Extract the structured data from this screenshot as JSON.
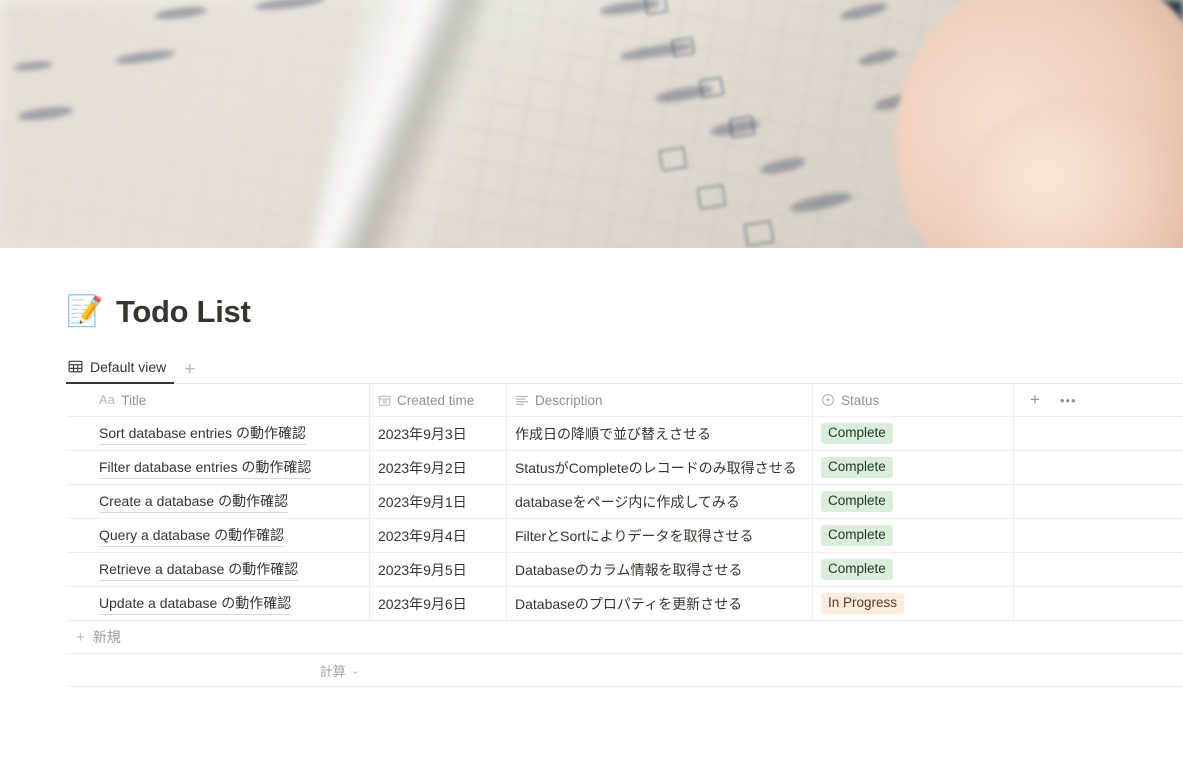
{
  "cover": {
    "alt": "blurred photo of a handwritten todo list on graph paper with a hand holding a pen"
  },
  "page": {
    "emoji": "📝",
    "title": "Todo List"
  },
  "view_tabs": {
    "tabs": [
      {
        "label": "Default view",
        "icon": "table-view-icon",
        "active": true
      }
    ],
    "add_label": "+"
  },
  "table": {
    "columns": [
      {
        "key": "title",
        "label": "Title",
        "icon": "title-text-icon"
      },
      {
        "key": "date",
        "label": "Created time",
        "icon": "calendar-icon"
      },
      {
        "key": "desc",
        "label": "Description",
        "icon": "text-lines-icon"
      },
      {
        "key": "status",
        "label": "Status",
        "icon": "select-circle-icon"
      }
    ],
    "header_actions": {
      "add": "+",
      "more": "•••"
    },
    "rows": [
      {
        "title": "Sort database entries の動作確認",
        "date": "2023年9月3日",
        "desc": "作成日の降順で並び替えさせる",
        "status": "Complete",
        "status_kind": "complete"
      },
      {
        "title": "Filter database entries の動作確認",
        "date": "2023年9月2日",
        "desc": "StatusがCompleteのレコードのみ取得させる",
        "status": "Complete",
        "status_kind": "complete"
      },
      {
        "title": "Create a database の動作確認",
        "date": "2023年9月1日",
        "desc": "databaseをページ内に作成してみる",
        "status": "Complete",
        "status_kind": "complete"
      },
      {
        "title": "Query a database の動作確認",
        "date": "2023年9月4日",
        "desc": "FilterとSortによりデータを取得させる",
        "status": "Complete",
        "status_kind": "complete"
      },
      {
        "title": "Retrieve a database の動作確認",
        "date": "2023年9月5日",
        "desc": "Databaseのカラム情報を取得させる",
        "status": "Complete",
        "status_kind": "complete"
      },
      {
        "title": "Update a database の動作確認",
        "date": "2023年9月6日",
        "desc": "Databaseのプロパティを更新させる",
        "status": "In Progress",
        "status_kind": "progress"
      }
    ],
    "new_row_label": "新規",
    "calculate_label": "計算"
  },
  "colors": {
    "text": "#37352f",
    "muted": "#92918d",
    "badge_complete_bg": "#dbeddb",
    "badge_complete_fg": "#1c3829",
    "badge_progress_bg": "#fbecdd",
    "badge_progress_fg": "#5c3b23",
    "border": "#eeeeec",
    "tab_active_underline": "#37352f"
  }
}
